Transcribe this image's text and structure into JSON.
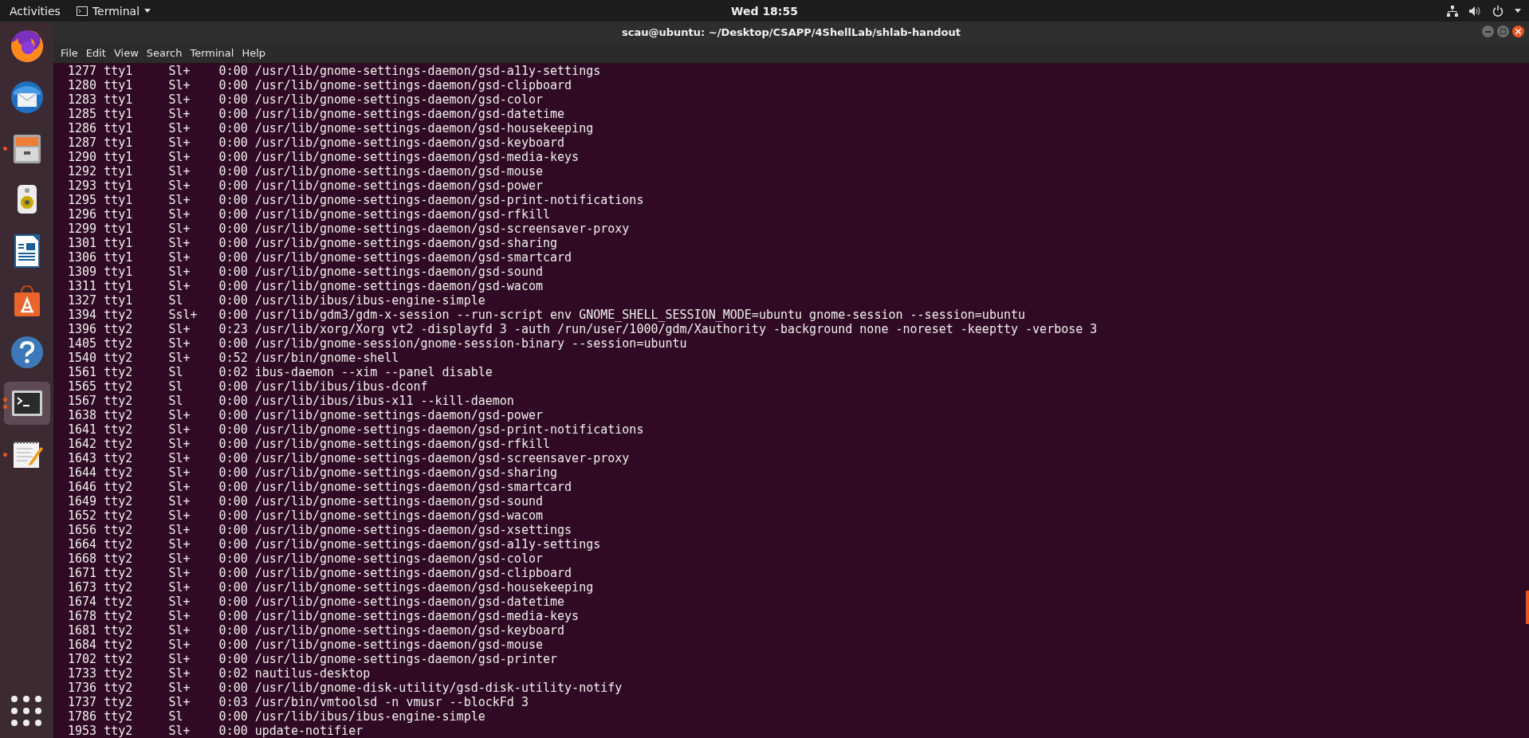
{
  "top_bar": {
    "activities": "Activities",
    "app_menu": "Terminal",
    "clock": "Wed 18:55"
  },
  "dock": {
    "items": [
      {
        "kind": "firefox",
        "running": false,
        "multiple_windows": false,
        "selected": false
      },
      {
        "kind": "mail",
        "running": false,
        "multiple_windows": false,
        "selected": false
      },
      {
        "kind": "files",
        "running": true,
        "multiple_windows": false,
        "selected": false
      },
      {
        "kind": "speaker",
        "running": false,
        "multiple_windows": false,
        "selected": false
      },
      {
        "kind": "writer",
        "running": false,
        "multiple_windows": false,
        "selected": false
      },
      {
        "kind": "store",
        "running": false,
        "multiple_windows": false,
        "selected": false
      },
      {
        "kind": "help",
        "running": false,
        "multiple_windows": false,
        "selected": false
      },
      {
        "kind": "terminal",
        "running": true,
        "multiple_windows": true,
        "selected": true
      },
      {
        "kind": "editor",
        "running": true,
        "multiple_windows": false,
        "selected": false
      }
    ]
  },
  "window": {
    "title": "scau@ubuntu: ~/Desktop/CSAPP/4ShellLab/shlab-handout",
    "menu": [
      "File",
      "Edit",
      "View",
      "Search",
      "Terminal",
      "Help"
    ],
    "rows": [
      [
        "1277",
        "tty1",
        "Sl+",
        "0:00",
        "/usr/lib/gnome-settings-daemon/gsd-a11y-settings"
      ],
      [
        "1280",
        "tty1",
        "Sl+",
        "0:00",
        "/usr/lib/gnome-settings-daemon/gsd-clipboard"
      ],
      [
        "1283",
        "tty1",
        "Sl+",
        "0:00",
        "/usr/lib/gnome-settings-daemon/gsd-color"
      ],
      [
        "1285",
        "tty1",
        "Sl+",
        "0:00",
        "/usr/lib/gnome-settings-daemon/gsd-datetime"
      ],
      [
        "1286",
        "tty1",
        "Sl+",
        "0:00",
        "/usr/lib/gnome-settings-daemon/gsd-housekeeping"
      ],
      [
        "1287",
        "tty1",
        "Sl+",
        "0:00",
        "/usr/lib/gnome-settings-daemon/gsd-keyboard"
      ],
      [
        "1290",
        "tty1",
        "Sl+",
        "0:00",
        "/usr/lib/gnome-settings-daemon/gsd-media-keys"
      ],
      [
        "1292",
        "tty1",
        "Sl+",
        "0:00",
        "/usr/lib/gnome-settings-daemon/gsd-mouse"
      ],
      [
        "1293",
        "tty1",
        "Sl+",
        "0:00",
        "/usr/lib/gnome-settings-daemon/gsd-power"
      ],
      [
        "1295",
        "tty1",
        "Sl+",
        "0:00",
        "/usr/lib/gnome-settings-daemon/gsd-print-notifications"
      ],
      [
        "1296",
        "tty1",
        "Sl+",
        "0:00",
        "/usr/lib/gnome-settings-daemon/gsd-rfkill"
      ],
      [
        "1299",
        "tty1",
        "Sl+",
        "0:00",
        "/usr/lib/gnome-settings-daemon/gsd-screensaver-proxy"
      ],
      [
        "1301",
        "tty1",
        "Sl+",
        "0:00",
        "/usr/lib/gnome-settings-daemon/gsd-sharing"
      ],
      [
        "1306",
        "tty1",
        "Sl+",
        "0:00",
        "/usr/lib/gnome-settings-daemon/gsd-smartcard"
      ],
      [
        "1309",
        "tty1",
        "Sl+",
        "0:00",
        "/usr/lib/gnome-settings-daemon/gsd-sound"
      ],
      [
        "1311",
        "tty1",
        "Sl+",
        "0:00",
        "/usr/lib/gnome-settings-daemon/gsd-wacom"
      ],
      [
        "1327",
        "tty1",
        "Sl",
        "0:00",
        "/usr/lib/ibus/ibus-engine-simple"
      ],
      [
        "1394",
        "tty2",
        "Ssl+",
        "0:00",
        "/usr/lib/gdm3/gdm-x-session --run-script env GNOME_SHELL_SESSION_MODE=ubuntu gnome-session --session=ubuntu"
      ],
      [
        "1396",
        "tty2",
        "Sl+",
        "0:23",
        "/usr/lib/xorg/Xorg vt2 -displayfd 3 -auth /run/user/1000/gdm/Xauthority -background none -noreset -keeptty -verbose 3"
      ],
      [
        "1405",
        "tty2",
        "Sl+",
        "0:00",
        "/usr/lib/gnome-session/gnome-session-binary --session=ubuntu"
      ],
      [
        "1540",
        "tty2",
        "Sl+",
        "0:52",
        "/usr/bin/gnome-shell"
      ],
      [
        "1561",
        "tty2",
        "Sl",
        "0:02",
        "ibus-daemon --xim --panel disable"
      ],
      [
        "1565",
        "tty2",
        "Sl",
        "0:00",
        "/usr/lib/ibus/ibus-dconf"
      ],
      [
        "1567",
        "tty2",
        "Sl",
        "0:00",
        "/usr/lib/ibus/ibus-x11 --kill-daemon"
      ],
      [
        "1638",
        "tty2",
        "Sl+",
        "0:00",
        "/usr/lib/gnome-settings-daemon/gsd-power"
      ],
      [
        "1641",
        "tty2",
        "Sl+",
        "0:00",
        "/usr/lib/gnome-settings-daemon/gsd-print-notifications"
      ],
      [
        "1642",
        "tty2",
        "Sl+",
        "0:00",
        "/usr/lib/gnome-settings-daemon/gsd-rfkill"
      ],
      [
        "1643",
        "tty2",
        "Sl+",
        "0:00",
        "/usr/lib/gnome-settings-daemon/gsd-screensaver-proxy"
      ],
      [
        "1644",
        "tty2",
        "Sl+",
        "0:00",
        "/usr/lib/gnome-settings-daemon/gsd-sharing"
      ],
      [
        "1646",
        "tty2",
        "Sl+",
        "0:00",
        "/usr/lib/gnome-settings-daemon/gsd-smartcard"
      ],
      [
        "1649",
        "tty2",
        "Sl+",
        "0:00",
        "/usr/lib/gnome-settings-daemon/gsd-sound"
      ],
      [
        "1652",
        "tty2",
        "Sl+",
        "0:00",
        "/usr/lib/gnome-settings-daemon/gsd-wacom"
      ],
      [
        "1656",
        "tty2",
        "Sl+",
        "0:00",
        "/usr/lib/gnome-settings-daemon/gsd-xsettings"
      ],
      [
        "1664",
        "tty2",
        "Sl+",
        "0:00",
        "/usr/lib/gnome-settings-daemon/gsd-a11y-settings"
      ],
      [
        "1668",
        "tty2",
        "Sl+",
        "0:00",
        "/usr/lib/gnome-settings-daemon/gsd-color"
      ],
      [
        "1671",
        "tty2",
        "Sl+",
        "0:00",
        "/usr/lib/gnome-settings-daemon/gsd-clipboard"
      ],
      [
        "1673",
        "tty2",
        "Sl+",
        "0:00",
        "/usr/lib/gnome-settings-daemon/gsd-housekeeping"
      ],
      [
        "1674",
        "tty2",
        "Sl+",
        "0:00",
        "/usr/lib/gnome-settings-daemon/gsd-datetime"
      ],
      [
        "1678",
        "tty2",
        "Sl+",
        "0:00",
        "/usr/lib/gnome-settings-daemon/gsd-media-keys"
      ],
      [
        "1681",
        "tty2",
        "Sl+",
        "0:00",
        "/usr/lib/gnome-settings-daemon/gsd-keyboard"
      ],
      [
        "1684",
        "tty2",
        "Sl+",
        "0:00",
        "/usr/lib/gnome-settings-daemon/gsd-mouse"
      ],
      [
        "1702",
        "tty2",
        "Sl+",
        "0:00",
        "/usr/lib/gnome-settings-daemon/gsd-printer"
      ],
      [
        "1733",
        "tty2",
        "Sl+",
        "0:02",
        "nautilus-desktop"
      ],
      [
        "1736",
        "tty2",
        "Sl+",
        "0:00",
        "/usr/lib/gnome-disk-utility/gsd-disk-utility-notify"
      ],
      [
        "1737",
        "tty2",
        "Sl+",
        "0:03",
        "/usr/bin/vmtoolsd -n vmusr --blockFd 3"
      ],
      [
        "1786",
        "tty2",
        "Sl",
        "0:00",
        "/usr/lib/ibus/ibus-engine-simple"
      ],
      [
        "1953",
        "tty2",
        "Sl+",
        "0:00",
        "update-notifier"
      ]
    ]
  }
}
